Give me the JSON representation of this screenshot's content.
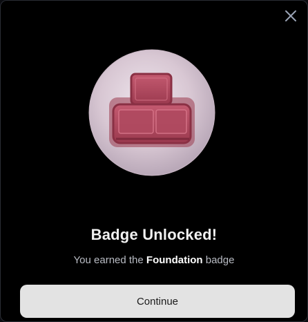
{
  "dialog": {
    "title": "Badge Unlocked!",
    "subtitle_prefix": "You earned the",
    "badge_name": "Foundation",
    "subtitle_suffix": "badge",
    "continue_label": "Continue",
    "close_icon": "close-icon",
    "badge_icon": "bricks-icon"
  },
  "colors": {
    "background": "#000000",
    "badge_disc": "#d8c7d3",
    "badge_emblem": "#b34a5f",
    "button_bg": "#e3e3e3"
  }
}
